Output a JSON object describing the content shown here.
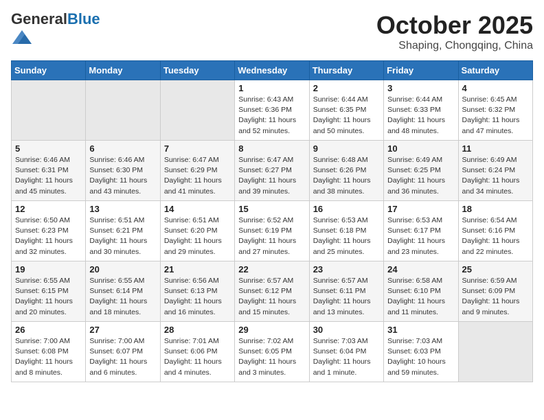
{
  "header": {
    "logo_general": "General",
    "logo_blue": "Blue",
    "month_title": "October 2025",
    "location": "Shaping, Chongqing, China"
  },
  "days_of_week": [
    "Sunday",
    "Monday",
    "Tuesday",
    "Wednesday",
    "Thursday",
    "Friday",
    "Saturday"
  ],
  "weeks": [
    [
      {
        "day": "",
        "info": ""
      },
      {
        "day": "",
        "info": ""
      },
      {
        "day": "",
        "info": ""
      },
      {
        "day": "1",
        "info": "Sunrise: 6:43 AM\nSunset: 6:36 PM\nDaylight: 11 hours\nand 52 minutes."
      },
      {
        "day": "2",
        "info": "Sunrise: 6:44 AM\nSunset: 6:35 PM\nDaylight: 11 hours\nand 50 minutes."
      },
      {
        "day": "3",
        "info": "Sunrise: 6:44 AM\nSunset: 6:33 PM\nDaylight: 11 hours\nand 48 minutes."
      },
      {
        "day": "4",
        "info": "Sunrise: 6:45 AM\nSunset: 6:32 PM\nDaylight: 11 hours\nand 47 minutes."
      }
    ],
    [
      {
        "day": "5",
        "info": "Sunrise: 6:46 AM\nSunset: 6:31 PM\nDaylight: 11 hours\nand 45 minutes."
      },
      {
        "day": "6",
        "info": "Sunrise: 6:46 AM\nSunset: 6:30 PM\nDaylight: 11 hours\nand 43 minutes."
      },
      {
        "day": "7",
        "info": "Sunrise: 6:47 AM\nSunset: 6:29 PM\nDaylight: 11 hours\nand 41 minutes."
      },
      {
        "day": "8",
        "info": "Sunrise: 6:47 AM\nSunset: 6:27 PM\nDaylight: 11 hours\nand 39 minutes."
      },
      {
        "day": "9",
        "info": "Sunrise: 6:48 AM\nSunset: 6:26 PM\nDaylight: 11 hours\nand 38 minutes."
      },
      {
        "day": "10",
        "info": "Sunrise: 6:49 AM\nSunset: 6:25 PM\nDaylight: 11 hours\nand 36 minutes."
      },
      {
        "day": "11",
        "info": "Sunrise: 6:49 AM\nSunset: 6:24 PM\nDaylight: 11 hours\nand 34 minutes."
      }
    ],
    [
      {
        "day": "12",
        "info": "Sunrise: 6:50 AM\nSunset: 6:23 PM\nDaylight: 11 hours\nand 32 minutes."
      },
      {
        "day": "13",
        "info": "Sunrise: 6:51 AM\nSunset: 6:21 PM\nDaylight: 11 hours\nand 30 minutes."
      },
      {
        "day": "14",
        "info": "Sunrise: 6:51 AM\nSunset: 6:20 PM\nDaylight: 11 hours\nand 29 minutes."
      },
      {
        "day": "15",
        "info": "Sunrise: 6:52 AM\nSunset: 6:19 PM\nDaylight: 11 hours\nand 27 minutes."
      },
      {
        "day": "16",
        "info": "Sunrise: 6:53 AM\nSunset: 6:18 PM\nDaylight: 11 hours\nand 25 minutes."
      },
      {
        "day": "17",
        "info": "Sunrise: 6:53 AM\nSunset: 6:17 PM\nDaylight: 11 hours\nand 23 minutes."
      },
      {
        "day": "18",
        "info": "Sunrise: 6:54 AM\nSunset: 6:16 PM\nDaylight: 11 hours\nand 22 minutes."
      }
    ],
    [
      {
        "day": "19",
        "info": "Sunrise: 6:55 AM\nSunset: 6:15 PM\nDaylight: 11 hours\nand 20 minutes."
      },
      {
        "day": "20",
        "info": "Sunrise: 6:55 AM\nSunset: 6:14 PM\nDaylight: 11 hours\nand 18 minutes."
      },
      {
        "day": "21",
        "info": "Sunrise: 6:56 AM\nSunset: 6:13 PM\nDaylight: 11 hours\nand 16 minutes."
      },
      {
        "day": "22",
        "info": "Sunrise: 6:57 AM\nSunset: 6:12 PM\nDaylight: 11 hours\nand 15 minutes."
      },
      {
        "day": "23",
        "info": "Sunrise: 6:57 AM\nSunset: 6:11 PM\nDaylight: 11 hours\nand 13 minutes."
      },
      {
        "day": "24",
        "info": "Sunrise: 6:58 AM\nSunset: 6:10 PM\nDaylight: 11 hours\nand 11 minutes."
      },
      {
        "day": "25",
        "info": "Sunrise: 6:59 AM\nSunset: 6:09 PM\nDaylight: 11 hours\nand 9 minutes."
      }
    ],
    [
      {
        "day": "26",
        "info": "Sunrise: 7:00 AM\nSunset: 6:08 PM\nDaylight: 11 hours\nand 8 minutes."
      },
      {
        "day": "27",
        "info": "Sunrise: 7:00 AM\nSunset: 6:07 PM\nDaylight: 11 hours\nand 6 minutes."
      },
      {
        "day": "28",
        "info": "Sunrise: 7:01 AM\nSunset: 6:06 PM\nDaylight: 11 hours\nand 4 minutes."
      },
      {
        "day": "29",
        "info": "Sunrise: 7:02 AM\nSunset: 6:05 PM\nDaylight: 11 hours\nand 3 minutes."
      },
      {
        "day": "30",
        "info": "Sunrise: 7:03 AM\nSunset: 6:04 PM\nDaylight: 11 hours\nand 1 minute."
      },
      {
        "day": "31",
        "info": "Sunrise: 7:03 AM\nSunset: 6:03 PM\nDaylight: 10 hours\nand 59 minutes."
      },
      {
        "day": "",
        "info": ""
      }
    ]
  ]
}
